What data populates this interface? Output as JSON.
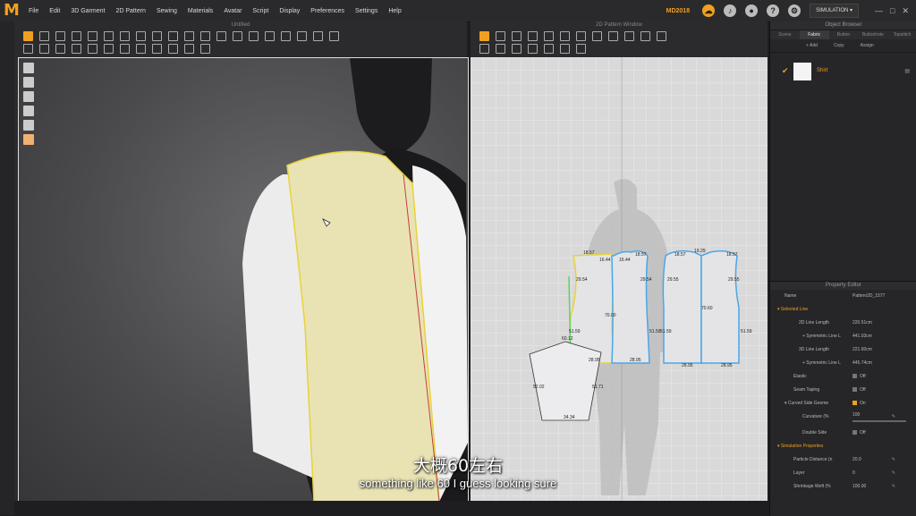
{
  "app": {
    "logo": "M",
    "version": "MD2018"
  },
  "menu": [
    "File",
    "Edit",
    "3D Garment",
    "2D Pattern",
    "Sewing",
    "Materials",
    "Avatar",
    "Script",
    "Display",
    "Preferences",
    "Settings",
    "Help"
  ],
  "toolbar_right": {
    "simulation_label": "SIMULATION",
    "win_min": "—",
    "win_max": "□",
    "win_close": "✕"
  },
  "viewport3d": {
    "title": "Untitled"
  },
  "viewport2d": {
    "title": "2D Pattern Window"
  },
  "object_browser": {
    "title": "Object Browser",
    "tabs": [
      "Scene",
      "Fabric",
      "Button",
      "Buttonhole",
      "Topstitch"
    ],
    "active_tab": "Fabric",
    "add_label": "+ Add",
    "copy_label": "Copy",
    "assign_label": "Assign",
    "fabric_name": "Shirt"
  },
  "property_editor": {
    "title": "Property Editor",
    "name_label": "Name",
    "name_value": "Pattern2D_1577",
    "selected_line": "Selected Line",
    "rows": [
      {
        "k": "2D Line Length",
        "v": "220.51cm"
      },
      {
        "k": "+ Symmetric Line L",
        "v": "441.03cm"
      },
      {
        "k": "3D Line Length",
        "v": "221.60cm"
      },
      {
        "k": "+ Symmetric Line L",
        "v": "445.74cm"
      },
      {
        "k": "Elastic",
        "v": "Off"
      },
      {
        "k": "Seam Taping",
        "v": "Off"
      },
      {
        "k": "Curved Side Geome",
        "v": "On"
      },
      {
        "k": "Curvature (%",
        "v": "100"
      },
      {
        "k": "Double Side",
        "v": "Off"
      }
    ],
    "sim_section": "Simulation Properties",
    "sim_rows": [
      {
        "k": "Particle Distance (n",
        "v": "20.0"
      },
      {
        "k": "Layer",
        "v": "0"
      },
      {
        "k": "Shrinkage Weft (%",
        "v": "100.00"
      }
    ]
  },
  "patterns": {
    "front": [
      "18.57",
      "16.44",
      "29.54",
      "51.59",
      "28.95",
      "70.00"
    ],
    "front2": [
      "16.44",
      "18.57",
      "29.54",
      "51.59",
      "28.95"
    ],
    "back": [
      "18.57",
      "19.29",
      "18.57",
      "29.55",
      "29.55",
      "51.59",
      "51.59",
      "28.95",
      "28.95",
      "70.60"
    ],
    "sleeve": [
      "60.12",
      "52.02",
      "51.71",
      "34.34"
    ]
  },
  "subtitles": {
    "chinese": "大概60左右",
    "english": "something like 60 I guess looking sure"
  }
}
